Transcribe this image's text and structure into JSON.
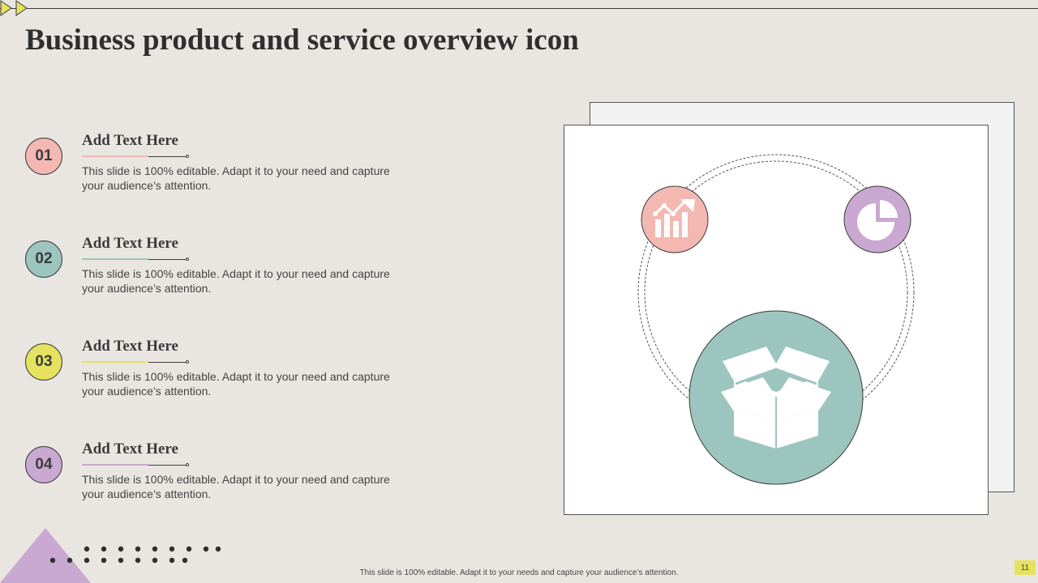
{
  "slide": {
    "title": "Business product and service overview icon",
    "page_number": "11",
    "footer_note": "This slide is 100% editable. Adapt it to your needs and capture your audience’s attention."
  },
  "items": [
    {
      "number": "01",
      "heading": "Add Text Here",
      "body": "This slide is 100% editable. Adapt it to your need and capture your audience’s attention.",
      "color": "#f4b8b3"
    },
    {
      "number": "02",
      "heading": "Add Text Here",
      "body": "This slide is 100% editable. Adapt it to your need and capture your audience’s attention.",
      "color": "#9cc5bf"
    },
    {
      "number": "03",
      "heading": "Add Text Here",
      "body": "This slide is 100% editable. Adapt it to your need and capture your audience’s attention.",
      "color": "#e4e25f"
    },
    {
      "number": "04",
      "heading": "Add Text Here",
      "body": "This slide is 100% editable. Adapt it to your need and capture your audience’s attention.",
      "color": "#c9a8d2"
    }
  ],
  "colors": {
    "background": "#e9e6e2",
    "pink": "#f4b8b3",
    "teal": "#9cc5bf",
    "yellow": "#e4e25f",
    "lavender": "#c9a8d2",
    "dark": "#3b3b3b"
  },
  "illustration": {
    "icons": [
      "growth-chart-icon",
      "pie-chart-icon",
      "open-box-icon"
    ]
  }
}
